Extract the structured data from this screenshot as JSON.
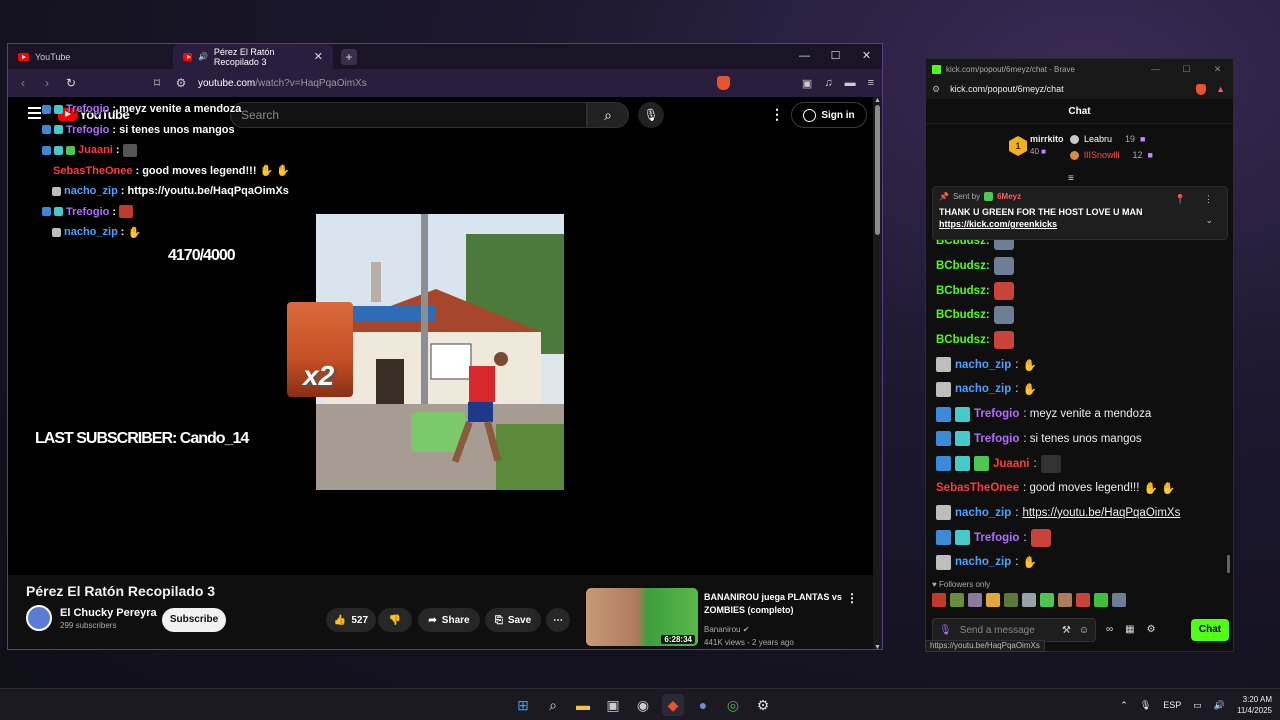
{
  "browser": {
    "tabs": [
      {
        "label": "YouTube",
        "active": false
      },
      {
        "label": "Pérez El Ratón Recopilado 3",
        "active": true
      }
    ],
    "url_host": "youtube.com",
    "url_path": "/watch?v=HaqPqaOimXs"
  },
  "youtube": {
    "logo": "YouTube",
    "search_placeholder": "Search",
    "signin_label": "Sign in",
    "video_title": "Pérez El Ratón Recopilado 3",
    "channel_name": "El Chucky Pereyra",
    "channel_subs": "299 subscribers",
    "subscribe_label": "Subscribe",
    "likes": "527",
    "share_label": "Share",
    "save_label": "Save",
    "recommended": {
      "title": "BANANIROU juega PLANTAS vs ZOMBIES (completo)",
      "channel": "Bananirou",
      "meta": "441K views - 2 years ago",
      "duration": "6:28:34"
    }
  },
  "overlay": {
    "chat": [
      {
        "user": "Trefogio",
        "color": "#b36cff",
        "text": ": meyz venite a mendoza"
      },
      {
        "user": "Trefogio",
        "color": "#b36cff",
        "text": ": si tenes unos mangos"
      },
      {
        "user": "Juaani",
        "color": "#ff3a3a",
        "text": ":"
      },
      {
        "user": "SebasTheOnee",
        "color": "#ff3a3a",
        "text": ": good moves legend!!!"
      },
      {
        "user": "nacho_zip",
        "color": "#4aa3ff",
        "text": ": https://youtu.be/HaqPqaOimXs"
      },
      {
        "user": "Trefogio",
        "color": "#b36cff",
        "text": ":"
      },
      {
        "user": "nacho_zip",
        "color": "#4aa3ff",
        "text": ":"
      }
    ],
    "counter": "4170/4000",
    "last_subscriber": "LAST SUBSCRIBER: Cando_14",
    "multiplier": "x2"
  },
  "kick": {
    "window_title": "kick.com/popout/6meyz/chat - Brave",
    "address": "kick.com/popout/6meyz/chat",
    "header": "Chat",
    "leaderboard": {
      "first_name": "mirrkito",
      "first_count": "40",
      "second_name": "Leabru",
      "second_count": "19",
      "third_name": "lIISnowlll",
      "third_count": "12"
    },
    "pinned": {
      "sent_by": "Sent by",
      "sender": "6Meyz",
      "message": "THANK U GREEN FOR THE HOST LOVE U MAN",
      "link": "https://kick.com/greenkicks"
    },
    "messages": [
      {
        "user": "BCbudsz:",
        "color": "#53fc18",
        "text": ""
      },
      {
        "user": "BCbudsz:",
        "color": "#53fc18",
        "text": ""
      },
      {
        "user": "BCbudsz:",
        "color": "#53fc18",
        "text": ""
      },
      {
        "user": "BCbudsz:",
        "color": "#53fc18",
        "text": ""
      },
      {
        "user": "nacho_zip",
        "color": "#4aa3ff",
        "text": ":"
      },
      {
        "user": "nacho_zip",
        "color": "#4aa3ff",
        "text": ":"
      },
      {
        "user": "Trefogio",
        "color": "#b36cff",
        "text": ": meyz venite a mendoza"
      },
      {
        "user": "Trefogio",
        "color": "#b36cff",
        "text": ": si tenes unos mangos"
      },
      {
        "user": "Juaani",
        "color": "#ff3a3a",
        "text": ":"
      },
      {
        "user": "SebasTheOnee",
        "color": "#ff3a3a",
        "text": ": good moves legend!!!"
      },
      {
        "user": "nacho_zip",
        "color": "#4aa3ff",
        "text": ":",
        "link": "https://youtu.be/HaqPqaOimXs"
      },
      {
        "user": "Trefogio",
        "color": "#b36cff",
        "text": ":"
      },
      {
        "user": "nacho_zip",
        "color": "#4aa3ff",
        "text": ":"
      }
    ],
    "followers_only": "Followers only",
    "input_placeholder": "Send a message",
    "send_label": "Chat",
    "status_url": "https://youtu.be/HaqPqaOimXs"
  },
  "taskbar": {
    "lang": "ESP",
    "time": "3:20 AM",
    "date": "11/4/2025"
  }
}
